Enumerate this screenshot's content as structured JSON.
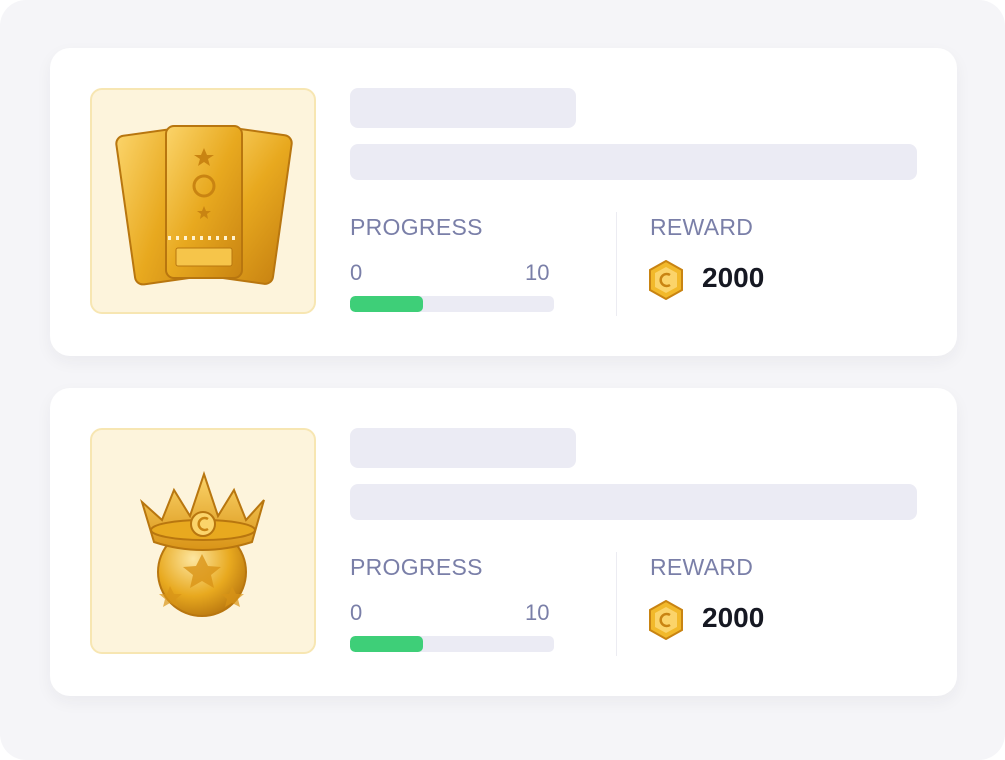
{
  "tasks": [
    {
      "image": "golden-tickets-icon",
      "progress_label": "PROGRESS",
      "progress_min": "0",
      "progress_max": "10",
      "progress_fraction": 0.36,
      "reward_label": "REWARD",
      "reward_value": "2000",
      "reward_icon": "gold-coin-icon"
    },
    {
      "image": "crowned-football-icon",
      "progress_label": "PROGRESS",
      "progress_min": "0",
      "progress_max": "10",
      "progress_fraction": 0.36,
      "reward_label": "REWARD",
      "reward_value": "2000",
      "reward_icon": "gold-coin-icon"
    }
  ],
  "colors": {
    "progress_fill": "#3ecf78",
    "progress_track": "#ebebf4",
    "skeleton": "#ebebf4",
    "thumb_bg": "#fdf4dc",
    "gold": "#e8a91f"
  }
}
